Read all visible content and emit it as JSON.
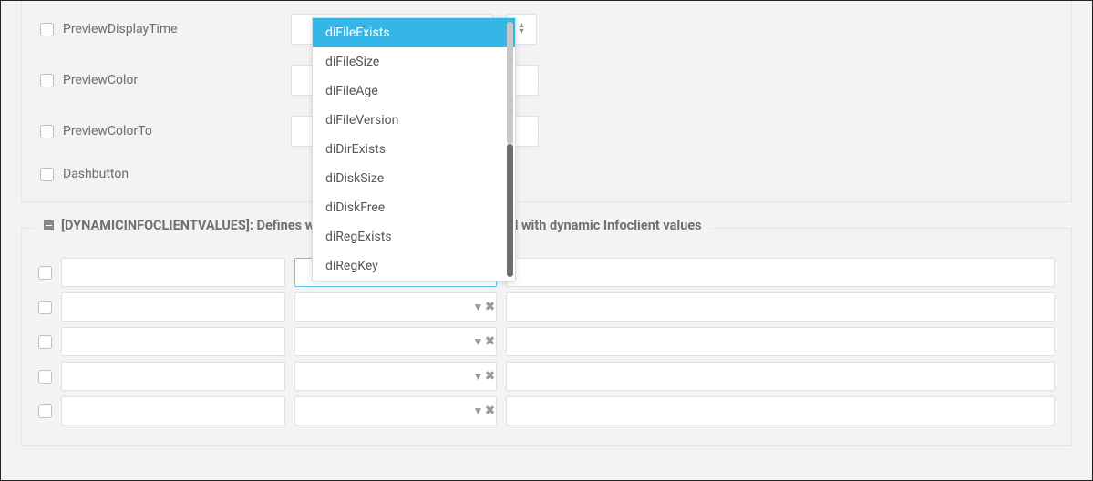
{
  "top_rows": [
    {
      "id": "preview-display-time",
      "label": "PreviewDisplayTime",
      "has_spinner": true
    },
    {
      "id": "preview-color",
      "label": "PreviewColor",
      "has_spinner": false
    },
    {
      "id": "preview-color-to",
      "label": "PreviewColorTo",
      "has_spinner": false
    },
    {
      "id": "dashbutton",
      "label": "Dashbutton",
      "no_field": true
    }
  ],
  "dropdown": {
    "selected_index": 0,
    "items": [
      "diFileExists",
      "diFileSize",
      "diFileAge",
      "diFileVersion",
      "diDirExists",
      "diDiskSize",
      "diDiskFree",
      "diRegExists",
      "diRegKey"
    ]
  },
  "group": {
    "title": "[DYNAMICINFOCLIENTVALUES]: Defines which informations can be retrieved with dynamic Infoclient values",
    "rows": 5
  }
}
